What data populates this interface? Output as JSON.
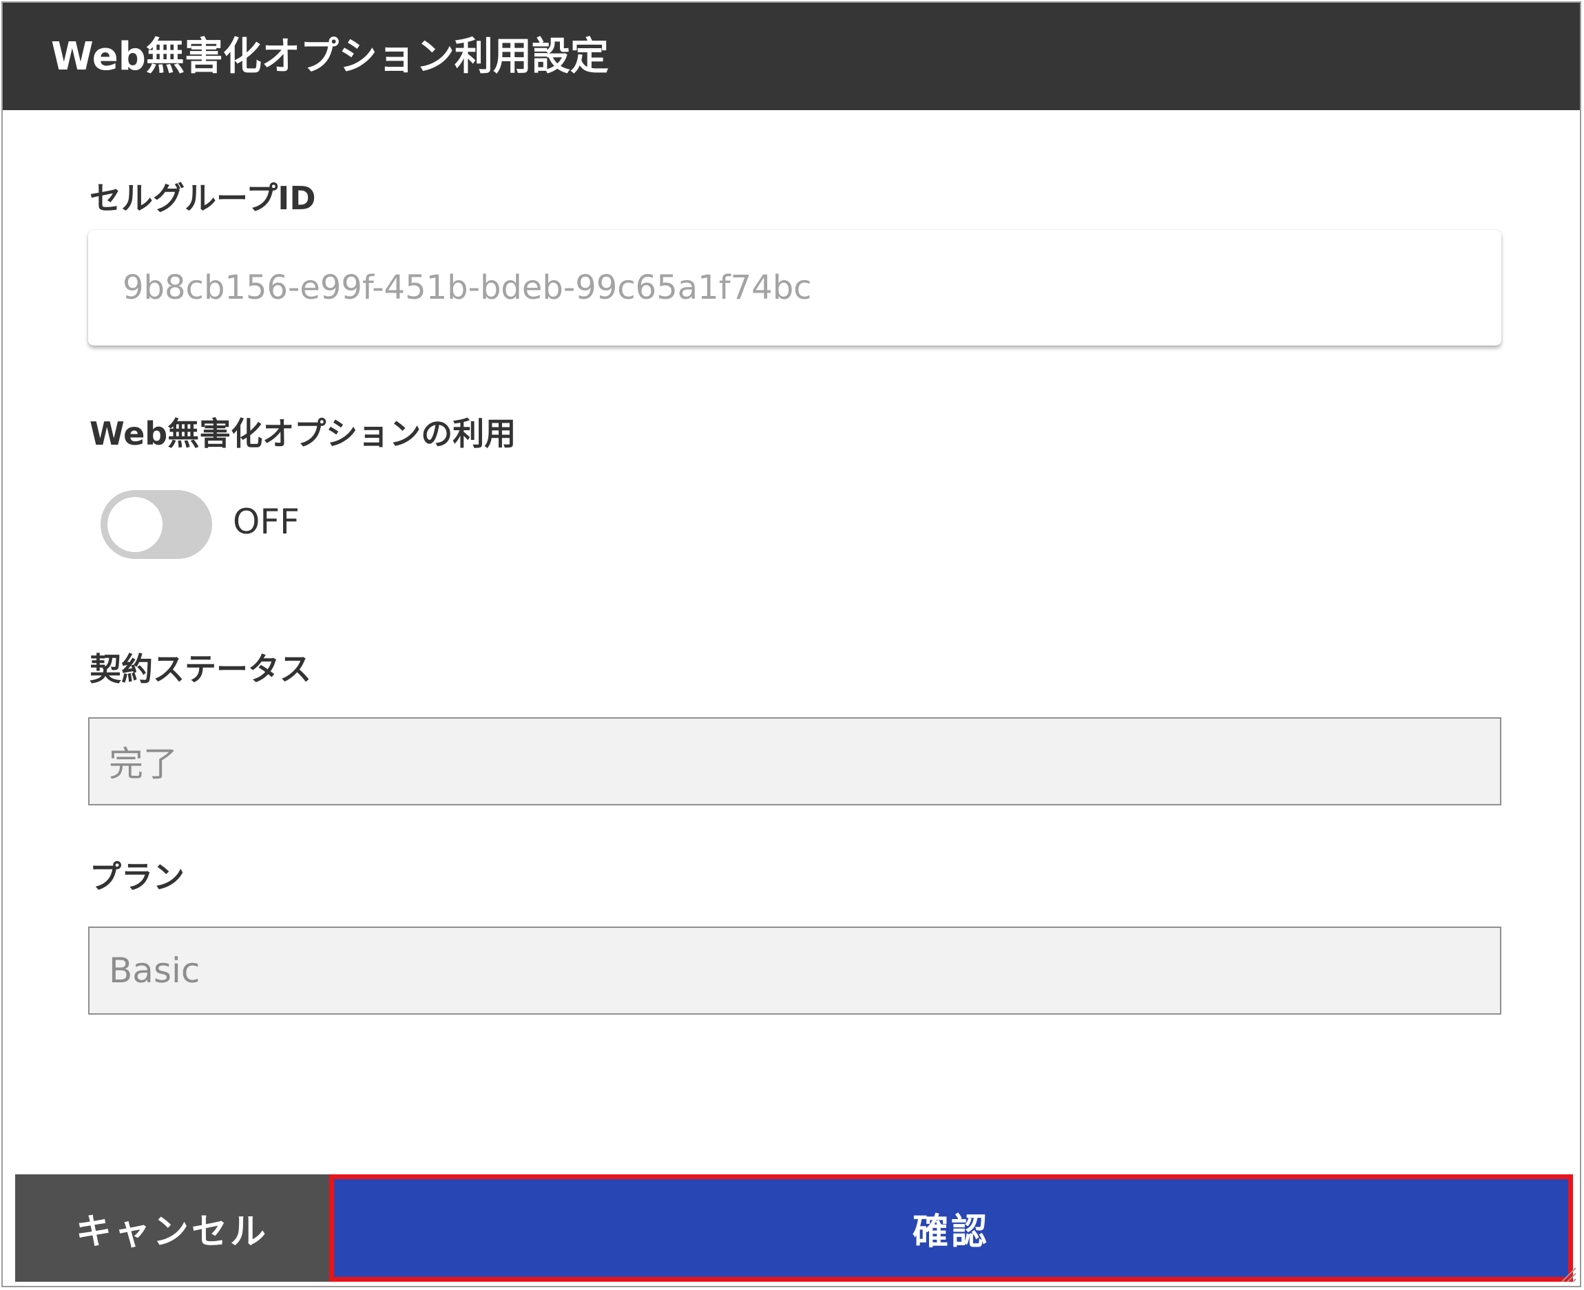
{
  "dialog": {
    "title": "Web無害化オプション利用設定"
  },
  "cell_group": {
    "label": "セルグループID",
    "value": "9b8cb156-e99f-451b-bdeb-99c65a1f74bc"
  },
  "web_option": {
    "label": "Web無害化オプションの利用",
    "toggle_state": "OFF"
  },
  "contract_status": {
    "label": "契約ステータス",
    "value": "完了"
  },
  "plan": {
    "label": "プラン",
    "value": "Basic"
  },
  "footer": {
    "cancel_label": "キャンセル",
    "confirm_label": "確認"
  },
  "colors": {
    "header_bg": "#363636",
    "confirm_bg": "#2847b5",
    "highlight_border": "#e8141a",
    "cancel_bg": "#505050",
    "toggle_off": "#cdcdcd"
  },
  "icons": {
    "resize": "resize-grip-icon"
  }
}
